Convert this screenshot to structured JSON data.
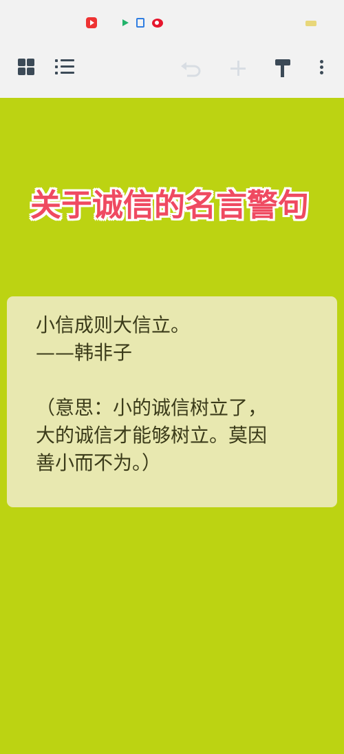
{
  "status_bar": {
    "apps": [
      "video-app-icon",
      "play-store-icon",
      "document-app-icon",
      "weibo-icon"
    ]
  },
  "toolbar": {
    "icons": [
      "grid-view-icon",
      "list-view-icon",
      "undo-icon",
      "add-icon",
      "paint-roller-icon",
      "more-options-icon"
    ]
  },
  "article": {
    "title": "关于诚信的名言警句",
    "quote_lines": [
      "小信成则大信立。",
      "——韩非子",
      "",
      "（意思：小的诚信树立了，",
      "大的诚信才能够树立。莫因",
      "善小而不为。）"
    ]
  },
  "colors": {
    "background": "#bcd312",
    "title": "#ef4a61",
    "card": "#e8e8b0",
    "bar": "#f2f2f2"
  }
}
